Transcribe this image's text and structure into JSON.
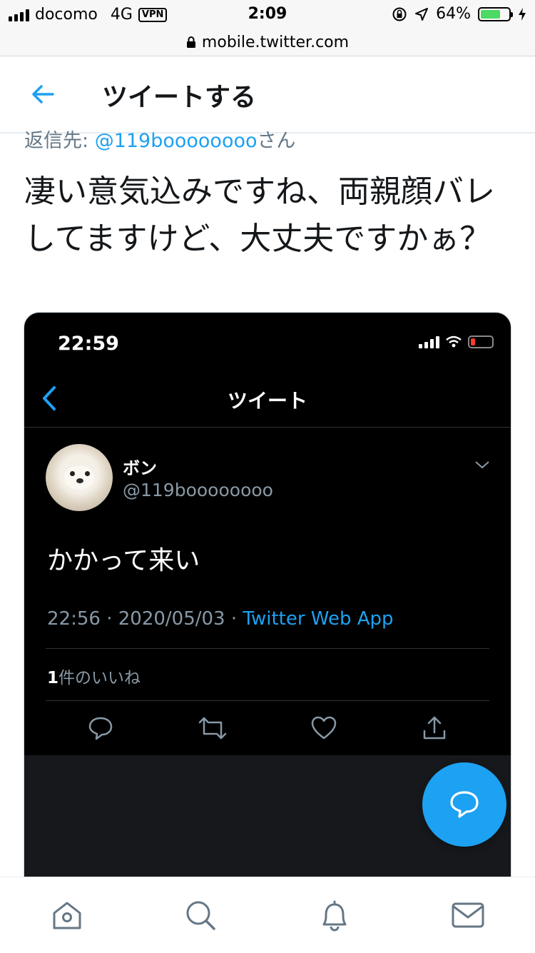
{
  "status_bar": {
    "carrier": "docomo",
    "network": "4G",
    "vpn": "VPN",
    "time": "2:09",
    "battery_percent": "64%",
    "battery_level": 0.64
  },
  "browser": {
    "url": "mobile.twitter.com"
  },
  "header": {
    "title": "ツイートする"
  },
  "reply": {
    "prefix": "返信先: ",
    "handle": "@119boooooooo",
    "suffix": "さん"
  },
  "tweet": {
    "text": "凄い意気込みですね、両親顔バレしてますけど、大丈夫ですかぁ？"
  },
  "embedded": {
    "status_time": "22:59",
    "title": "ツイート",
    "name": "ボン",
    "handle": "@119boooooooo",
    "body": "かかって来い",
    "time": "22:56",
    "date": "2020/05/03",
    "source": "Twitter Web App",
    "like_count": "1",
    "like_label": "件のいいね",
    "sep": "·"
  },
  "icons": {
    "back": "arrow-left-icon",
    "compose": "reply-bubble-icon",
    "tabs": [
      "home-icon",
      "search-icon",
      "bell-icon",
      "mail-icon"
    ]
  },
  "colors": {
    "accent": "#1da1f2",
    "dark_bg": "#000000"
  }
}
